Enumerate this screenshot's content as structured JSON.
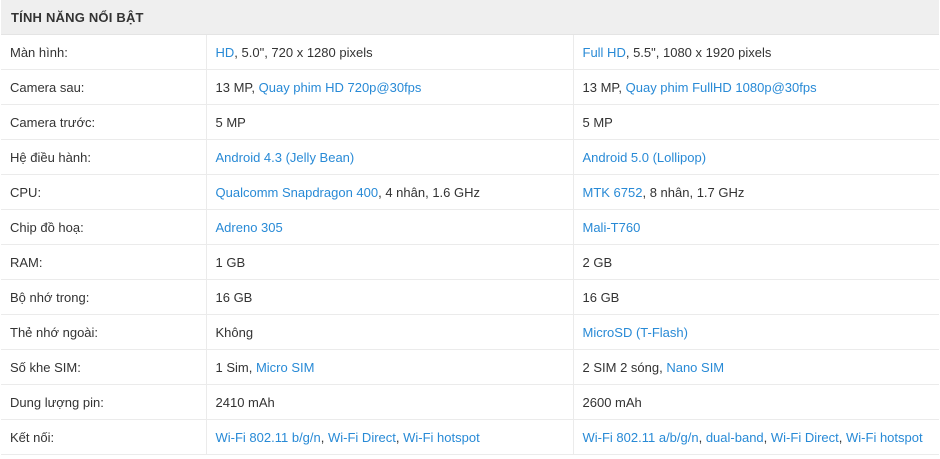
{
  "section_title": "TÍNH NĂNG NỔI BẬT",
  "colors": {
    "link": "#288ad6",
    "text": "#333333",
    "header_bg": "#efefef",
    "border": "#ebebeb"
  },
  "rows": [
    {
      "label": "Màn hình:",
      "a": [
        {
          "t": "HD",
          "link": true
        },
        {
          "t": ", 5.0\", 720 x 1280 pixels"
        }
      ],
      "b": [
        {
          "t": "Full HD",
          "link": true
        },
        {
          "t": ", 5.5\", 1080 x 1920 pixels"
        }
      ]
    },
    {
      "label": "Camera sau:",
      "a": [
        {
          "t": "13 MP, "
        },
        {
          "t": "Quay phim HD 720p@30fps",
          "link": true
        }
      ],
      "b": [
        {
          "t": "13 MP, "
        },
        {
          "t": "Quay phim FullHD 1080p@30fps",
          "link": true
        }
      ]
    },
    {
      "label": "Camera trước:",
      "a": [
        {
          "t": "5 MP"
        }
      ],
      "b": [
        {
          "t": "5 MP"
        }
      ]
    },
    {
      "label": "Hệ điều hành:",
      "a": [
        {
          "t": "Android 4.3 (Jelly Bean)",
          "link": true
        }
      ],
      "b": [
        {
          "t": "Android 5.0 (Lollipop)",
          "link": true
        }
      ]
    },
    {
      "label": "CPU:",
      "a": [
        {
          "t": "Qualcomm Snapdragon 400",
          "link": true
        },
        {
          "t": ", 4 nhân, 1.6 GHz"
        }
      ],
      "b": [
        {
          "t": "MTK 6752",
          "link": true
        },
        {
          "t": ", 8 nhân, 1.7 GHz"
        }
      ]
    },
    {
      "label": "Chip đồ hoạ:",
      "a": [
        {
          "t": "Adreno 305",
          "link": true
        }
      ],
      "b": [
        {
          "t": "Mali-T760",
          "link": true
        }
      ]
    },
    {
      "label": "RAM:",
      "a": [
        {
          "t": "1 GB"
        }
      ],
      "b": [
        {
          "t": "2 GB"
        }
      ]
    },
    {
      "label": "Bộ nhớ trong:",
      "a": [
        {
          "t": "16 GB"
        }
      ],
      "b": [
        {
          "t": "16 GB"
        }
      ]
    },
    {
      "label": "Thẻ nhớ ngoài:",
      "a": [
        {
          "t": "Không"
        }
      ],
      "b": [
        {
          "t": "MicroSD (T-Flash)",
          "link": true
        }
      ]
    },
    {
      "label": "Số khe SIM:",
      "a": [
        {
          "t": "1 Sim, "
        },
        {
          "t": "Micro SIM",
          "link": true
        }
      ],
      "b": [
        {
          "t": "2 SIM 2 sóng, "
        },
        {
          "t": "Nano SIM",
          "link": true
        }
      ]
    },
    {
      "label": "Dung lượng pin:",
      "a": [
        {
          "t": "2410 mAh"
        }
      ],
      "b": [
        {
          "t": "2600 mAh"
        }
      ]
    },
    {
      "label": "Kết nối:",
      "a": [
        {
          "t": "Wi-Fi 802.11 b/g/n",
          "link": true
        },
        {
          "t": ", "
        },
        {
          "t": "Wi-Fi Direct",
          "link": true
        },
        {
          "t": ", "
        },
        {
          "t": "Wi-Fi hotspot",
          "link": true
        }
      ],
      "b": [
        {
          "t": "Wi-Fi 802.11 a/b/g/n",
          "link": true
        },
        {
          "t": ", "
        },
        {
          "t": "dual-band",
          "link": true
        },
        {
          "t": ", "
        },
        {
          "t": "Wi-Fi Direct",
          "link": true
        },
        {
          "t": ", "
        },
        {
          "t": "Wi-Fi hotspot",
          "link": true
        }
      ]
    }
  ]
}
